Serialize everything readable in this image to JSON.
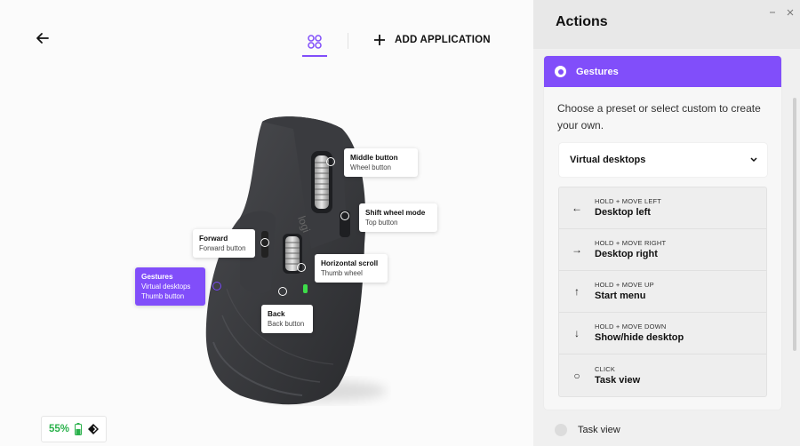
{
  "header": {
    "back_icon": "arrow-left-icon",
    "apps_icon": "grid-circles-icon",
    "add_application": "ADD APPLICATION",
    "accent": "#814efa"
  },
  "callouts": {
    "middle": {
      "title": "Middle button",
      "sub": "Wheel button"
    },
    "shift": {
      "title": "Shift wheel mode",
      "sub": "Top button"
    },
    "forward": {
      "title": "Forward",
      "sub": "Forward button"
    },
    "horizontal": {
      "title": "Horizontal scroll",
      "sub": "Thumb wheel"
    },
    "gestures": {
      "title": "Gestures",
      "sub1": "Virtual desktops",
      "sub2": "Thumb button"
    },
    "back": {
      "title": "Back",
      "sub": "Back button"
    }
  },
  "battery": {
    "percent": "55%",
    "level": 0.55,
    "color": "#2bb24c"
  },
  "panel": {
    "title": "Actions",
    "selected_action": "Gestures",
    "description": "Choose a preset or select custom to create your own.",
    "preset": "Virtual desktops",
    "gestures": [
      {
        "icon": "arrow-left-icon",
        "glyph": "←",
        "hint": "HOLD + MOVE LEFT",
        "action": "Desktop left"
      },
      {
        "icon": "arrow-right-icon",
        "glyph": "→",
        "hint": "HOLD + MOVE RIGHT",
        "action": "Desktop right"
      },
      {
        "icon": "arrow-up-icon",
        "glyph": "↑",
        "hint": "HOLD + MOVE UP",
        "action": "Start menu"
      },
      {
        "icon": "arrow-down-icon",
        "glyph": "↓",
        "hint": "HOLD + MOVE DOWN",
        "action": "Show/hide desktop"
      },
      {
        "icon": "circle-icon",
        "glyph": "○",
        "hint": "CLICK",
        "action": "Task view"
      }
    ],
    "next_option": "Task view"
  }
}
